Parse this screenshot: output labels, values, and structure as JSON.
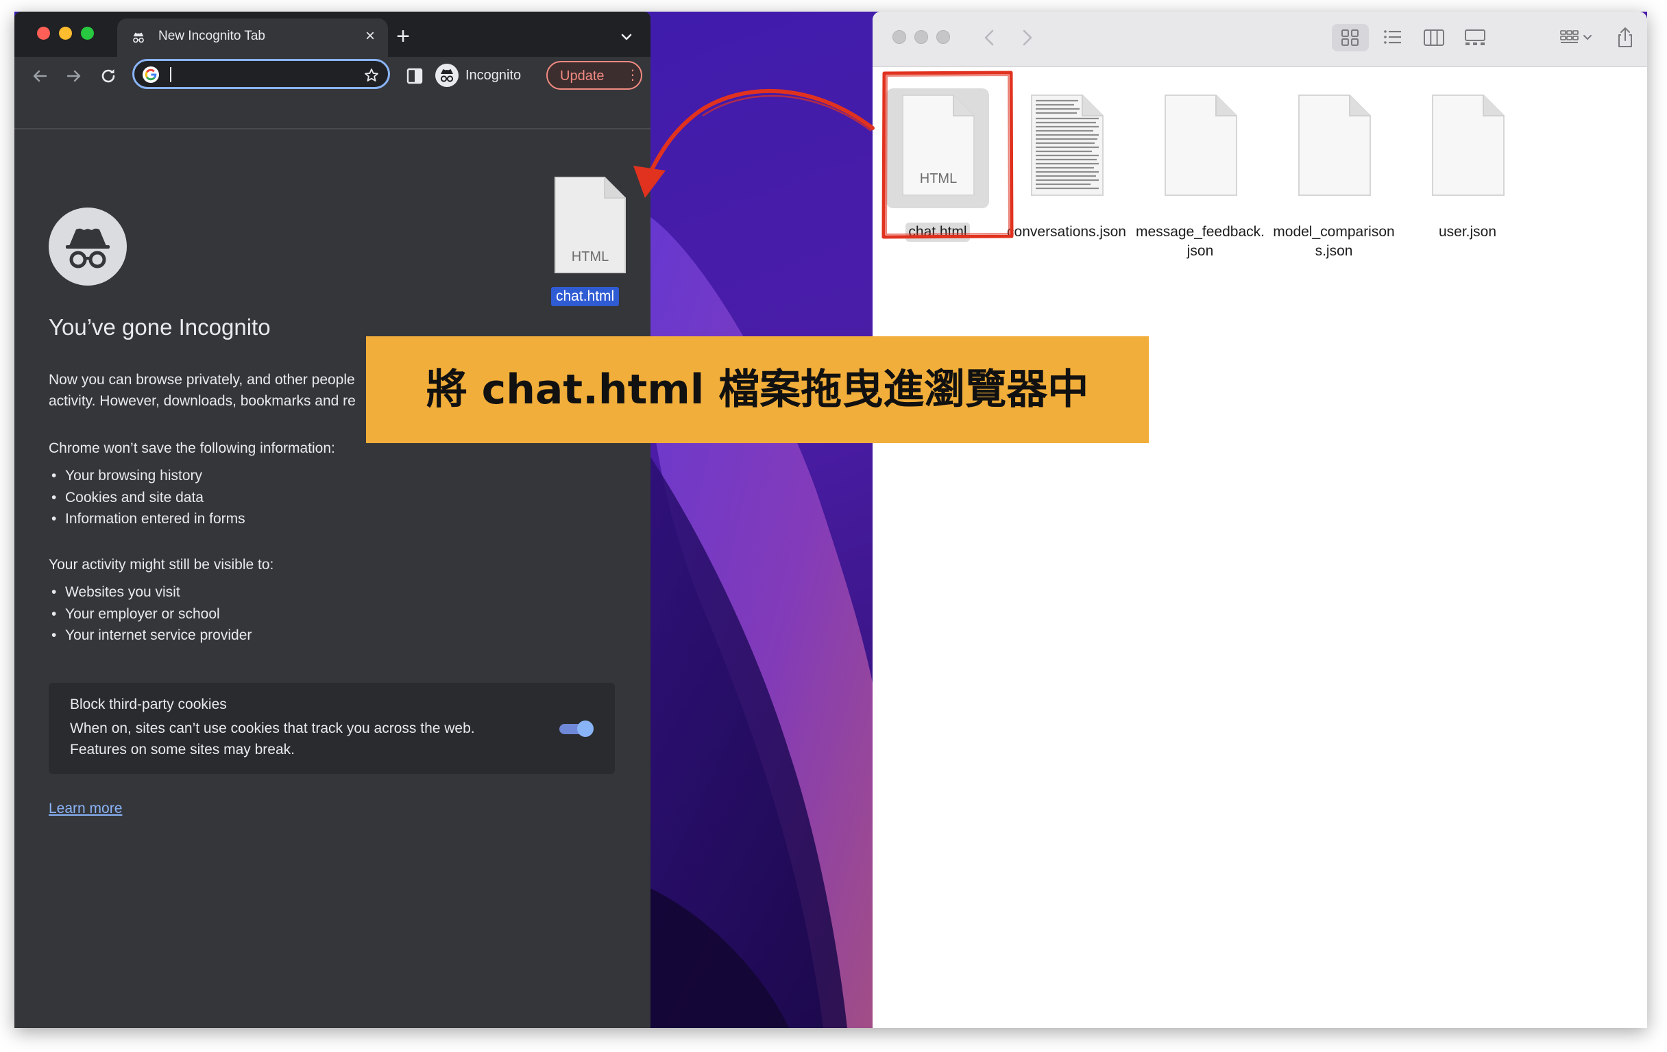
{
  "chrome": {
    "tab": {
      "title": "New Incognito Tab",
      "close_icon": "close-icon"
    },
    "toolbar": {
      "omnibox_value": "",
      "profile_label": "Incognito",
      "update_label": "Update",
      "menu_glyph": "⋮"
    },
    "ntp": {
      "title": "You’ve gone Incognito",
      "intro_line1": "Now you can browse privately, and other people",
      "intro_line2": "activity. However, downloads, bookmarks and re",
      "not_saved_heading": "Chrome won’t save the following information:",
      "not_saved_items": [
        "Your browsing history",
        "Cookies and site data",
        "Information entered in forms"
      ],
      "visible_heading": "Your activity might still be visible to:",
      "visible_items": [
        "Websites you visit",
        "Your employer or school",
        "Your internet service provider"
      ],
      "cookie_card": {
        "title": "Block third-party cookies",
        "desc_line1": "When on, sites can’t use cookies that track you across the web.",
        "desc_line2": "Features on some sites may break.",
        "enabled": true
      },
      "learn_more": "Learn more"
    }
  },
  "dragged_file": {
    "badge": "HTML",
    "label": "chat.html"
  },
  "finder": {
    "files": [
      {
        "label": "chat.html",
        "badge": "HTML",
        "selected": true,
        "kind": "html"
      },
      {
        "label": "conversations.json",
        "selected": false,
        "kind": "text-preview"
      },
      {
        "label": "message_feedback.json",
        "selected": false,
        "kind": "blank"
      },
      {
        "label": "model_comparisons.json",
        "selected": false,
        "kind": "blank"
      },
      {
        "label": "user.json",
        "selected": false,
        "kind": "blank"
      }
    ]
  },
  "banner": {
    "text": "將 chat.html 檔案拖曳進瀏覽器中"
  },
  "colors": {
    "banner_bg": "#f2ae3a",
    "highlight_red": "#e0321f",
    "chrome_bg": "#35363a",
    "chrome_accent": "#8ab4f8",
    "update_red": "#f28b82",
    "drag_selection": "#2f5bd3"
  }
}
